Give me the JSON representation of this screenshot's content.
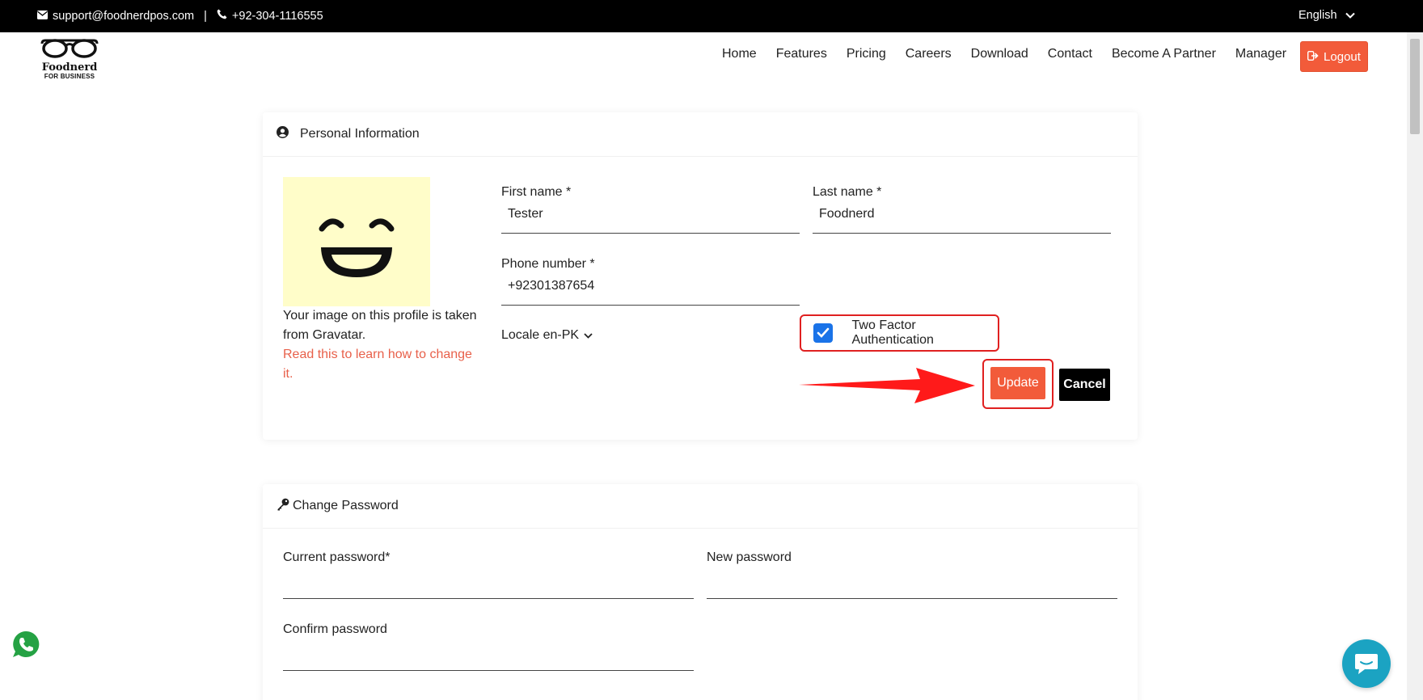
{
  "topbar": {
    "email": "support@foodnerdpos.com",
    "separator": "|",
    "phone": "+92-304-1116555",
    "language": "English"
  },
  "header": {
    "logo_brand": "Foodnerd",
    "logo_sub": "FOR BUSINESS",
    "nav": [
      "Home",
      "Features",
      "Pricing",
      "Careers",
      "Download",
      "Contact",
      "Become A Partner",
      "Manager"
    ],
    "logout_label": "Logout"
  },
  "personal_info": {
    "title": "Personal Information",
    "avatar_text": "Your image on this profile is taken from Gravatar.",
    "avatar_link": "Read this to learn how to change it.",
    "first_name_label": "First name *",
    "first_name_value": "Tester",
    "last_name_label": "Last name *",
    "last_name_value": "Foodnerd",
    "phone_label": "Phone number *",
    "phone_value": "+92301387654",
    "locale_label": "Locale en-PK",
    "two_factor_label": "Two Factor Authentication",
    "two_factor_checked": true,
    "update_label": "Update",
    "cancel_label": "Cancel"
  },
  "change_password": {
    "title": "Change Password",
    "current_label": "Current password*",
    "new_label": "New password",
    "confirm_label": "Confirm password"
  },
  "colors": {
    "accent": "#f25b3a",
    "link": "#e8604a",
    "highlight": "#e02020",
    "checkbox": "#1a73e8",
    "chat": "#1ba3c2",
    "avatar_bg": "#fffdc9"
  },
  "icons": {
    "email": "envelope-icon",
    "phone": "phone-icon",
    "language": "chevron-down-icon",
    "logout": "sign-out-icon",
    "personal": "user-circle-icon",
    "password": "key-icon",
    "whatsapp": "whatsapp-icon",
    "chat": "chat-icon"
  }
}
